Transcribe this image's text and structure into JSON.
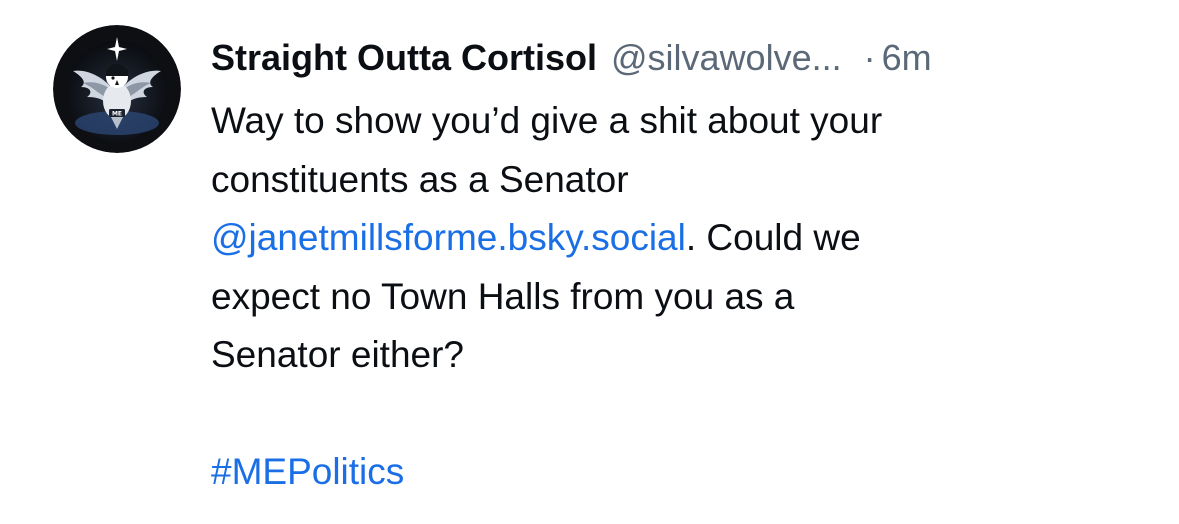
{
  "post": {
    "author": {
      "display_name": "Straight Outta Cortisol",
      "handle": "@silvawolve...",
      "avatar_icon": "bird-emblem-avatar-icon",
      "avatar_badge": "ME"
    },
    "separator": "·",
    "time": "6m",
    "text_lines": [
      {
        "plain": "Way to show you’d give a shit about your"
      },
      {
        "plain": "constituents as a Senator"
      },
      {
        "mention": "@janetmillsforme.bsky.social",
        "plain_after": ". Could we"
      },
      {
        "plain": "expect no Town Halls from you as a"
      },
      {
        "plain": "Senator either?"
      }
    ],
    "hashtag": "#MEPolitics"
  },
  "colors": {
    "link": "#1a6fe6",
    "muted": "#5b6877",
    "text": "#0b0f14",
    "background": "#ffffff"
  }
}
